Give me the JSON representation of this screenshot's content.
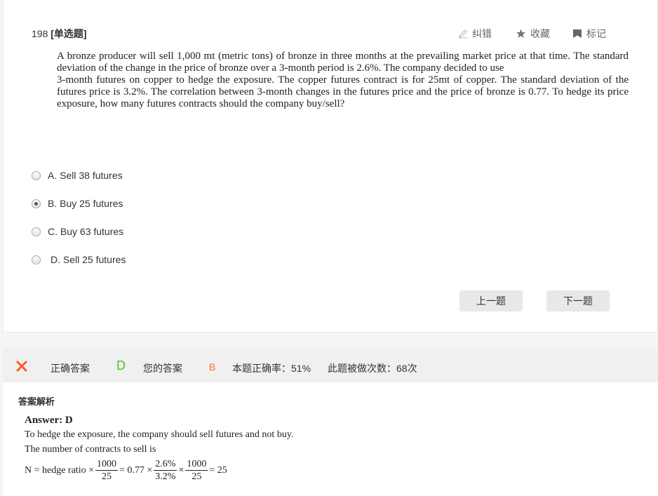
{
  "question": {
    "number": "198",
    "type": "[单选题]",
    "tools": {
      "report": "纠错",
      "favorite": "收藏",
      "mark": "标记"
    },
    "stem_paragraphs": [
      "A bronze producer will sell 1,000 mt (metric tons) of bronze in three months at the prevailing market price at that time. The standard deviation of the change in the price of bronze over a 3-month period is 2.6%. The company decided to use",
      "3-month futures on copper to hedge the exposure. The copper futures contract is for 25mt of copper. The standard deviation of the futures price is 3.2%. The correlation between 3-month changes in the futures price and the price of bronze is 0.77. To hedge its price exposure, how many futures contracts should the company buy/sell?"
    ],
    "options": [
      {
        "label": "A. Sell 38 futures",
        "checked": false
      },
      {
        "label": "B. Buy 25 futures",
        "checked": true
      },
      {
        "label": "C. Buy 63 futures",
        "checked": false
      },
      {
        "label": "D. Sell 25 futures",
        "checked": false
      }
    ],
    "prev_button": "上一题",
    "next_button": "下一题"
  },
  "result": {
    "status_icon": "wrong-x-icon",
    "correct_label": "正确答案",
    "correct_value": "D",
    "your_label": "您的答案",
    "your_value": "B",
    "accuracy": "本题正确率：51%",
    "attempts": "此题被做次数：68次"
  },
  "analysis": {
    "title": "答案解析",
    "answer": "Answer: D",
    "line1": "To hedge the exposure, the company should sell futures and not buy.",
    "line2": "The number of contracts to sell is",
    "formula": {
      "lhs": "N = hedge ratio ×",
      "f1_num": "1000",
      "f1_den": "25",
      "mid": "= 0.77 ×",
      "f2_num": "2.6%",
      "f2_den": "3.2%",
      "times": "×",
      "f3_num": "1000",
      "f3_den": "25",
      "result": "= 25"
    }
  },
  "colors": {
    "wrong": "#ff5a1f",
    "correct": "#52c41a",
    "user_wrong": "#ff6a2c",
    "button_bg": "#e8e8e8"
  }
}
